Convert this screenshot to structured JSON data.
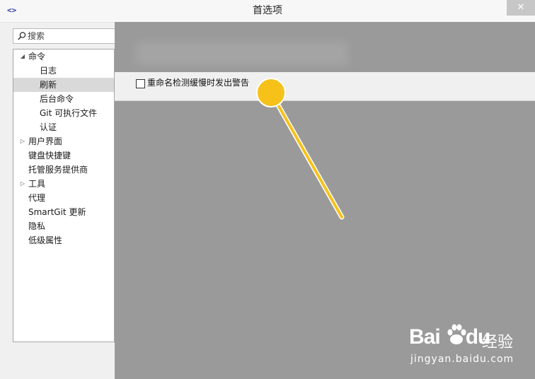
{
  "window": {
    "title": "首选项",
    "app_icon_glyph": "<>",
    "close_glyph": "✕"
  },
  "search": {
    "placeholder": "搜索",
    "value": ""
  },
  "tree": {
    "items": [
      {
        "label": "命令",
        "expanded": true,
        "level": 0
      },
      {
        "label": "日志",
        "level": 1
      },
      {
        "label": "刷新",
        "level": 1,
        "selected": true
      },
      {
        "label": "后台命令",
        "level": 1
      },
      {
        "label": "Git 可执行文件",
        "level": 1
      },
      {
        "label": "认证",
        "level": 1
      },
      {
        "label": "用户界面",
        "expanded": false,
        "level": 0
      },
      {
        "label": "键盘快捷键",
        "level": 0
      },
      {
        "label": "托管服务提供商",
        "level": 0
      },
      {
        "label": "工具",
        "expanded": false,
        "level": 0
      },
      {
        "label": "代理",
        "level": 0
      },
      {
        "label": "SmartGit 更新",
        "level": 0
      },
      {
        "label": "隐私",
        "level": 0
      },
      {
        "label": "低级属性",
        "level": 0
      }
    ]
  },
  "settings": {
    "rename_detection_warning": {
      "label": "重命名检测缓慢时发出警告",
      "checked": false
    }
  },
  "watermark": {
    "brand": "Bai",
    "brand2": "du",
    "cn": "经验",
    "url": "jingyan.baidu.com"
  },
  "colors": {
    "accent_pointer": "#f6c21a",
    "pointer_stroke": "#e8a800",
    "overlay_gray": "#9a9a9a"
  }
}
